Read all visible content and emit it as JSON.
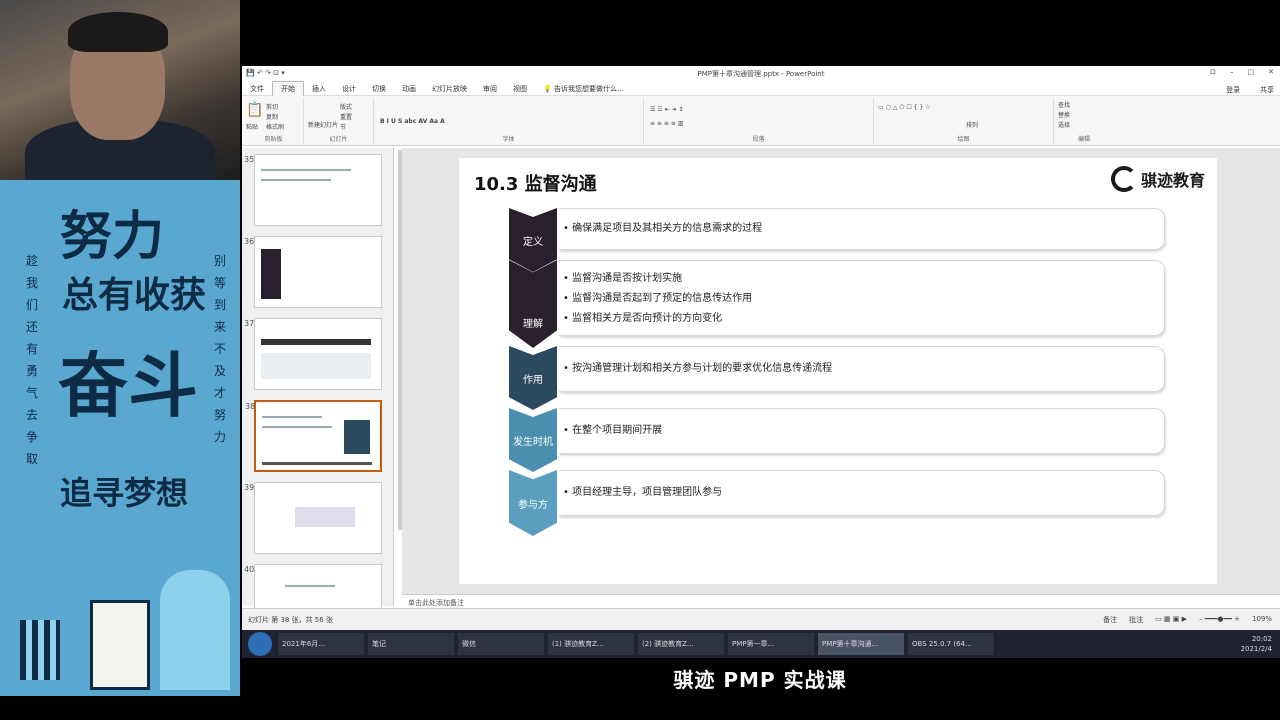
{
  "poster": {
    "line1": "努力",
    "line2": "总有收获",
    "line3": "奋斗",
    "line4": "追寻梦想",
    "side_left": "趁我们还有勇气去争取",
    "side_right": "别等到来不及才努力"
  },
  "window": {
    "title": "PMP第十章沟通管理.pptx - PowerPoint",
    "login": "登录",
    "share": "共享",
    "tabs": [
      "文件",
      "开始",
      "插入",
      "设计",
      "切换",
      "动画",
      "幻灯片放映",
      "审阅",
      "视图"
    ],
    "tell_me": "告诉我您想要做什么..."
  },
  "ribbon": {
    "groups": [
      "剪贴板",
      "幻灯片",
      "字体",
      "段落",
      "绘图",
      "编辑"
    ],
    "buttons": {
      "paste": "粘贴",
      "cut": "剪切",
      "copy": "复制",
      "format_painter": "格式刷",
      "new_slide": "新建幻灯片",
      "layout": "版式",
      "reset": "重置",
      "section": "节",
      "arrange": "排列",
      "find": "查找",
      "replace": "替换",
      "select": "选择"
    }
  },
  "thumbnails": [
    {
      "num": "35",
      "selected": false
    },
    {
      "num": "36",
      "selected": false
    },
    {
      "num": "37",
      "selected": false
    },
    {
      "num": "38",
      "selected": true
    },
    {
      "num": "39",
      "selected": false
    },
    {
      "num": "40",
      "selected": false
    }
  ],
  "slide": {
    "title": "10.3 监督沟通",
    "logo": "骐迹教育",
    "rows": [
      {
        "label": "定义",
        "color": "#2a1f2d",
        "items": [
          "确保满足项目及其相关方的信息需求的过程"
        ]
      },
      {
        "label": "理解",
        "color": "#2a1f2d",
        "items": [
          "监督沟通是否按计划实施",
          "监督沟通是否起到了预定的信息传达作用",
          "监督相关方是否向预计的方向变化"
        ]
      },
      {
        "label": "作用",
        "color": "#2b4a5e",
        "items": [
          "按沟通管理计划和相关方参与计划的要求优化信息传递流程"
        ]
      },
      {
        "label": "发生时机",
        "color": "#4a8fb0",
        "items": [
          "在整个项目期间开展"
        ]
      },
      {
        "label": "参与方",
        "color": "#5a9fbf",
        "items": [
          "项目经理主导，项目管理团队参与"
        ]
      }
    ]
  },
  "notes_placeholder": "单击此处添加备注",
  "status": {
    "slide_info": "幻灯片 第 38 张，共 56 张",
    "notes": "备注",
    "comments": "批注",
    "zoom": "109%"
  },
  "taskbar": {
    "tasks": [
      "2021年6月...",
      "笔记",
      "微信",
      "(1) 骐迹教育Z...",
      "(2) 骐迹教育Z...",
      "PMP第一章...",
      "PMP第十章沟通...",
      "OBS 25.0.7 (64..."
    ],
    "active_index": 6,
    "time": "20:02",
    "date": "2021/2/4"
  },
  "caption": "骐迹 PMP 实战课"
}
